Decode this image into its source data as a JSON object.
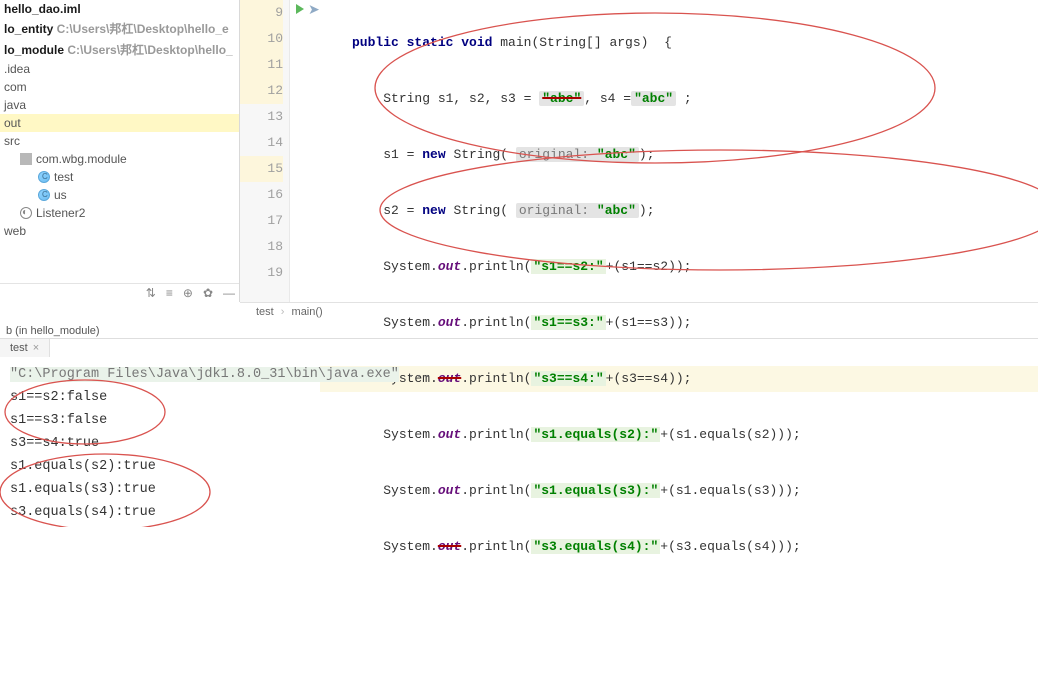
{
  "project": {
    "items": [
      {
        "label": "hello_dao.iml",
        "bold": true
      },
      {
        "label": "lo_entity",
        "hint": " C:\\Users\\邦杠\\Desktop\\hello_e",
        "bold": true
      },
      {
        "label": "lo_module",
        "hint": " C:\\Users\\邦杠\\Desktop\\hello_",
        "bold": true
      },
      {
        "label": ".idea"
      },
      {
        "label": "com"
      },
      {
        "label": "java"
      },
      {
        "label": "out",
        "selected": true
      },
      {
        "label": "src"
      },
      {
        "label": "com.wbg.module",
        "folder": true,
        "indent": 1
      },
      {
        "label": "test",
        "class": true,
        "indent": 2
      },
      {
        "label": "us",
        "class": true,
        "indent": 2
      },
      {
        "label": "Listener2",
        "listen": true,
        "indent": 1
      },
      {
        "label": "web"
      }
    ]
  },
  "toolbar": {
    "i1": "⇅",
    "i2": "≡",
    "i3": "⊕",
    "i4": "✿",
    "i5": "—"
  },
  "editor": {
    "lines": [
      "9",
      "10",
      "11",
      "12",
      "13",
      "14",
      "15",
      "16",
      "17",
      "18",
      "19"
    ],
    "code": {
      "l9": {
        "pre": "public static void",
        "mid": " main(String[] args)  {"
      },
      "l10": {
        "t1": "String s1, s2, s3 = ",
        "s1": "\"abc\"",
        "t2": ", s4 =",
        "s2": "\"abc\"",
        "t3": " ;"
      },
      "l11": {
        "t1": "s1 = ",
        "k": "new",
        "t2": " String( ",
        "hint": "original:",
        "s": "\"abc\"",
        "t3": ");"
      },
      "l12": {
        "t1": "s2 = ",
        "k": "new",
        "t2": " String( ",
        "hint": "original:",
        "s": "\"abc\"",
        "t3": ");"
      },
      "l13": {
        "t1": "System.",
        "f": "out",
        "t2": ".println(",
        "s": "\"s1==s2:\"",
        "t3": "+(s1==s2));"
      },
      "l14": {
        "t1": "System.",
        "f": "out",
        "t2": ".println(",
        "s": "\"s1==s3:\"",
        "t3": "+(s1==s3));"
      },
      "l15": {
        "t1": "System.",
        "f": "out",
        "t2": ".println(",
        "s": "\"s3==s4:\"",
        "t3": "+(s3==s4));"
      },
      "l16": {
        "t1": "System.",
        "f": "out",
        "t2": ".println(",
        "s": "\"s1.equals(s2):\"",
        "t3": "+(s1.equals(s2)));"
      },
      "l17": {
        "t1": "System.",
        "f": "out",
        "t2": ".println(",
        "s": "\"s1.equals(s3):\"",
        "t3": "+(s1.equals(s3)));"
      },
      "l18": {
        "t1": "System.",
        "f": "out",
        "t2": ".println(",
        "s": "\"s3.equals(s4):\"",
        "t3": "+(s3.equals(s4)));"
      }
    },
    "breadcrumb": {
      "a": "test",
      "b": "main()"
    }
  },
  "run": {
    "header": "b (in hello_module)",
    "tab": "test",
    "console": {
      "cmd": "\"C:\\Program Files\\Java\\jdk1.8.0_31\\bin\\java.exe\"",
      "dots": " ...",
      "lines": [
        "s1==s2:false",
        "s1==s3:false",
        "s3==s4:true",
        "s1.equals(s2):true",
        "s1.equals(s3):true",
        "s3.equals(s4):true"
      ]
    }
  }
}
